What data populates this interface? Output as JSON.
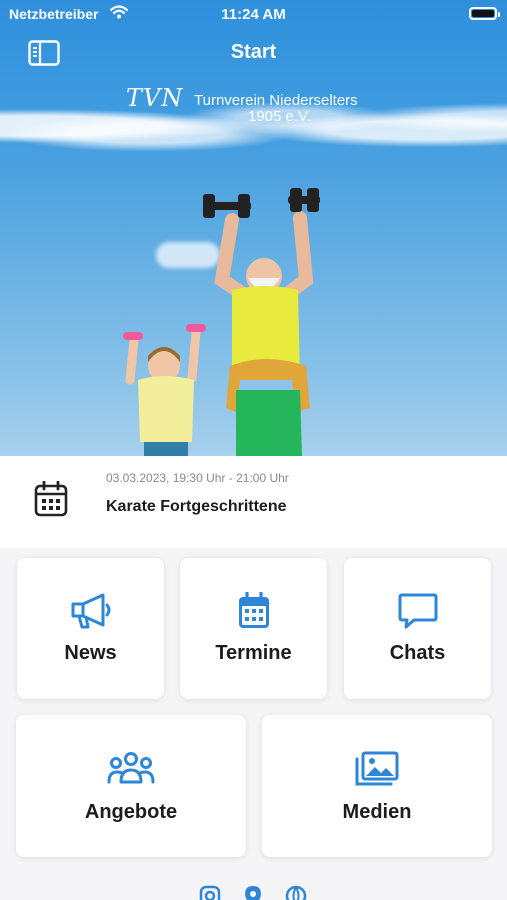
{
  "status_bar": {
    "carrier": "Netzbetreiber",
    "time": "11:24 AM"
  },
  "nav": {
    "title": "Start",
    "menu_icon": "sidebar-icon"
  },
  "logo": {
    "mark": "TVN",
    "name": "Turnverein Niederselters",
    "year": "1905 e.V."
  },
  "event": {
    "datetime": "03.03.2023, 19:30 Uhr - 21:00 Uhr",
    "name": "Karate Fortgeschrittene",
    "icon": "calendar-icon"
  },
  "tiles": [
    {
      "label": "News",
      "icon": "megaphone-icon"
    },
    {
      "label": "Termine",
      "icon": "calendar-icon"
    },
    {
      "label": "Chats",
      "icon": "chat-bubble-icon"
    },
    {
      "label": "Angebote",
      "icon": "group-icon"
    },
    {
      "label": "Medien",
      "icon": "gallery-icon"
    }
  ],
  "social": [
    "instagram-icon",
    "location-icon",
    "globe-icon"
  ],
  "colors": {
    "accent": "#2e86d6",
    "nav_bg": "#2f8fdc",
    "tile_bg": "#ffffff",
    "page_bg": "#f5f5f7"
  }
}
